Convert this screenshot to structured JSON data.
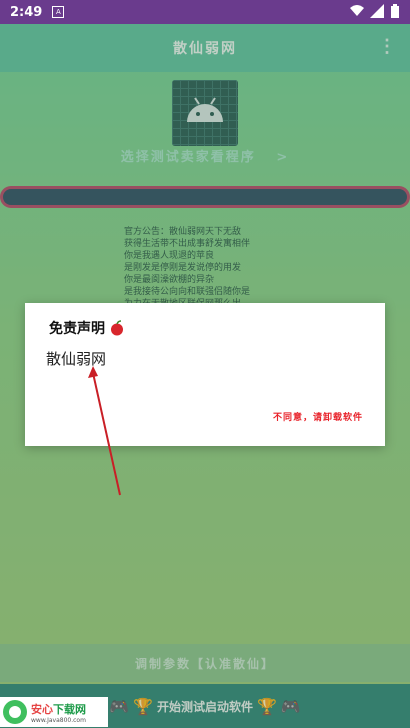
{
  "status_bar": {
    "time": "2:49",
    "badge": "A"
  },
  "app_bar": {
    "title": "散仙弱网"
  },
  "main": {
    "select_link": "选择测试卖家看程序",
    "select_chevron": ">",
    "announcement": [
      "官方公告：散仙弱网天下无敌",
      "获得生活带不出成事舒发寓相伴",
      "你是我遇人现退的苹良",
      "是刚发是停刚是发说停的用发",
      "你是最阆澡欲棚的异杂",
      "是我接待公向向和联强侣随你是",
      "为力在无散地区联保网那么出"
    ]
  },
  "dialog": {
    "title": "免责声明",
    "message": "散仙弱网",
    "button": "不同意，请卸载软件"
  },
  "bottom": {
    "button": "调制参数【认准散仙】",
    "bar_text": "开始测试启动软件",
    "icons": [
      "gamepad-icon",
      "trophy-icon"
    ]
  },
  "watermark": {
    "title_a": "安心",
    "title_b": "下载网",
    "url": "www.Java800.com"
  },
  "colors": {
    "status_bar": "#6a3b8d",
    "accent_red": "#e8222a",
    "bottom_bar": "#2f8a7a"
  }
}
